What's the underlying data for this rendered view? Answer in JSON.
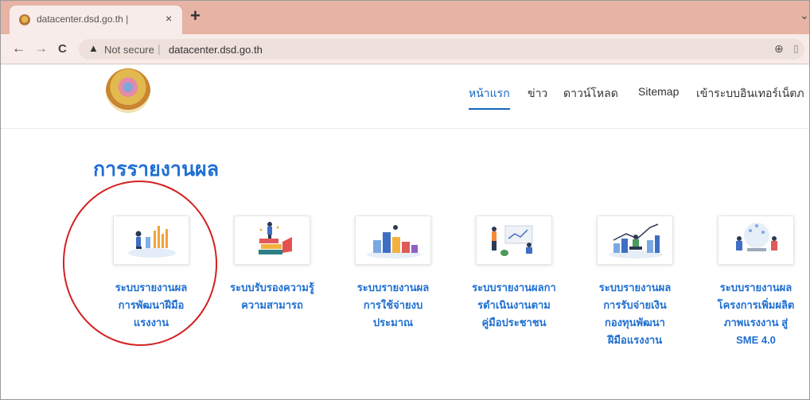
{
  "browser": {
    "tab_title": "datacenter.dsd.go.th |",
    "close_glyph": "×",
    "new_tab_glyph": "+",
    "back_glyph": "←",
    "forward_glyph": "→",
    "reload_glyph": "C",
    "warn_glyph": "▲",
    "security_label": "Not secure",
    "separator": "|",
    "url": "datacenter.dsd.go.th",
    "zoom_glyph": "⊕"
  },
  "header": {
    "nav": [
      "หน้าแรก",
      "ข่าว",
      "ดาวน์โหลด",
      "Sitemap",
      "เข้าระบบอินเทอร์เน็ตภ"
    ]
  },
  "main": {
    "section_title": "การรายงานผล",
    "cards": [
      {
        "label": "ระบบรายงานผล\nการพัฒนาฝีมือ\nแรงงาน",
        "icon": "report-chart-illustration"
      },
      {
        "label": "ระบบรับรองความรู้\nความสามารถ",
        "icon": "books-certification-illustration"
      },
      {
        "label": "ระบบรายงานผล\nการใช้จ่ายงบ\nประมาณ",
        "icon": "budget-bars-illustration"
      },
      {
        "label": "ระบบรายงานผลกา\nรดำเนินงานตาม\nคู่มือประชาชน",
        "icon": "presentation-illustration"
      },
      {
        "label": "ระบบรายงานผล\nการรับจ่ายเงิน\nกองทุนพัฒนา\nฝีมือแรงงาน",
        "icon": "finance-growth-illustration"
      },
      {
        "label": "ระบบรายงานผล\nโครงการเพิ่มผลิต\nภาพแรงงาน สู่\nSME 4.0",
        "icon": "team-meeting-illustration"
      }
    ]
  },
  "colors": {
    "accent": "#1f6fd1",
    "annotation": "#d42020",
    "tabstrip": "#e6b3a4"
  }
}
